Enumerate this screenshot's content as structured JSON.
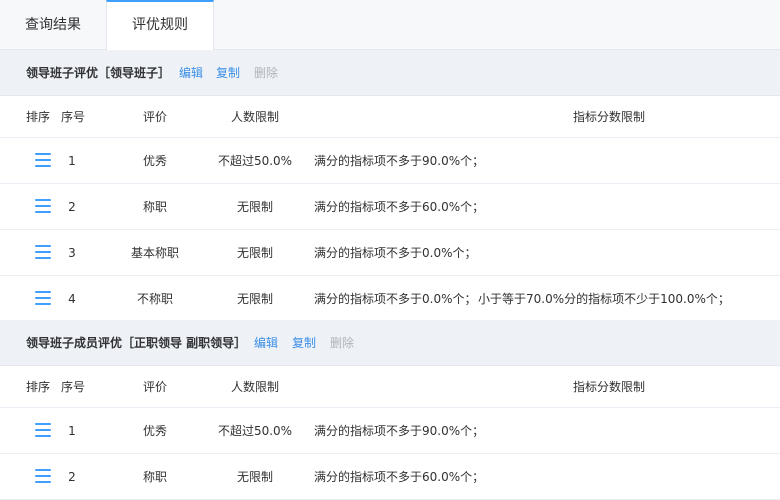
{
  "tabs": [
    {
      "label": "查询结果"
    },
    {
      "label": "评优规则"
    }
  ],
  "columns": {
    "sort": "排序",
    "index": "序号",
    "grade": "评价",
    "count_limit": "人数限制",
    "score_limit": "指标分数限制"
  },
  "sections": [
    {
      "title": "领导班子评优［领导班子］",
      "edit": "编辑",
      "copy": "复制",
      "delete": "删除",
      "rows": [
        {
          "index": "1",
          "grade": "优秀",
          "limit": "不超过50.0%",
          "rule1": "满分的指标项不多于90.0%个；",
          "rule2": ""
        },
        {
          "index": "2",
          "grade": "称职",
          "limit": "无限制",
          "rule1": "满分的指标项不多于60.0%个；",
          "rule2": ""
        },
        {
          "index": "3",
          "grade": "基本称职",
          "limit": "无限制",
          "rule1": "满分的指标项不多于0.0%个；",
          "rule2": ""
        },
        {
          "index": "4",
          "grade": "不称职",
          "limit": "无限制",
          "rule1": "满分的指标项不多于0.0%个；",
          "rule2": "小于等于70.0%分的指标项不少于100.0%个；"
        }
      ]
    },
    {
      "title": "领导班子成员评优［正职领导 副职领导］",
      "edit": "编辑",
      "copy": "复制",
      "delete": "删除",
      "rows": [
        {
          "index": "1",
          "grade": "优秀",
          "limit": "不超过50.0%",
          "rule1": "满分的指标项不多于90.0%个；",
          "rule2": ""
        },
        {
          "index": "2",
          "grade": "称职",
          "limit": "无限制",
          "rule1": "满分的指标项不多于60.0%个；",
          "rule2": ""
        }
      ]
    }
  ]
}
